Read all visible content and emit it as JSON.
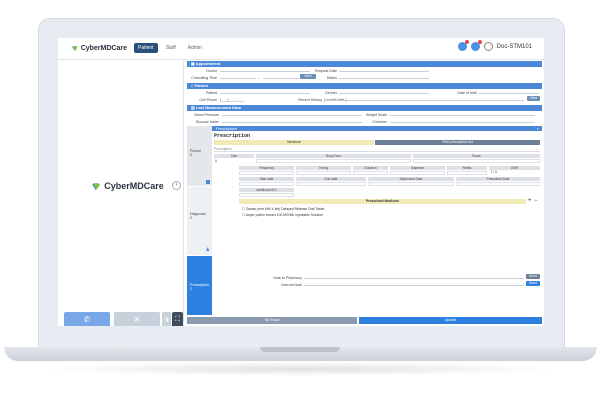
{
  "app": {
    "brand": "CyberMDCare"
  },
  "nav": {
    "items": [
      "Patient",
      "Staff",
      "Admin"
    ]
  },
  "user": {
    "name": "Doc-STM101"
  },
  "sections": {
    "appointment": "Appointment",
    "patient": "Patient",
    "last_measurement": "Last Measurement Data"
  },
  "appointment": {
    "doctor_label": "Doctor",
    "request_date_label": "Request Date",
    "consulting_time_label": "Consulting Time",
    "dash": "-",
    "view_label": "View",
    "status_label": "Status"
  },
  "patient": {
    "patient_label": "Patient",
    "gender_label": "Gender",
    "dob_label": "Date of birth",
    "cell_label": "Cell Phone",
    "cell_value": "(___)___-____",
    "recent_history_label": "Recent History",
    "recent_history_value": "( invalid date )",
    "view_label": "View"
  },
  "measurement": {
    "bp_label": "Blood Pressure",
    "weight_label": "Weight Scale",
    "glucose_label": "Glucose meter",
    "oximeter_label": "Oximeter"
  },
  "side": {
    "picture": "Picture",
    "picture_count": "0",
    "diagnosis": "Diagnosis",
    "diagnosis_count": "2",
    "prescription": "Prescription",
    "prescription_count": "2"
  },
  "prescription": {
    "bar_label": "Prescription",
    "title": "Prescription",
    "tab_medicine": "Medicine",
    "tab_print": "Print prescription list",
    "search_label": "Prescription",
    "size_label": "Size",
    "drug_form_label": "Drug Form",
    "route_label": "Route",
    "qty_value": "0",
    "frequency_label": "Frequency",
    "timing_label": "Timing",
    "duration_label": "Duration",
    "dispense_label": "Dispense",
    "refills_label": "Refills",
    "dnr_label": "DNR",
    "refill_count": "0",
    "start_label": "Start date",
    "end_label": "End date",
    "dispensed_label": "Dispensed Date",
    "prescribed_label": "Prescribed Date",
    "additional_label": "Additional SIG",
    "prescribed_med_label": "Prescribed Medicine",
    "meds": [
      "Zantac (ehe Mfv X-lim) Delayed Release Oral Tablet",
      "Asper potlex extract 100 MG/ML Injectable Solution"
    ],
    "note_pharmacy_label": "Note to Pharmacy",
    "internal_note_label": "Internal Note",
    "send_label": "Send",
    "send2_label": "Send"
  },
  "footer": {
    "no_show": "No Show",
    "update": "Update"
  }
}
